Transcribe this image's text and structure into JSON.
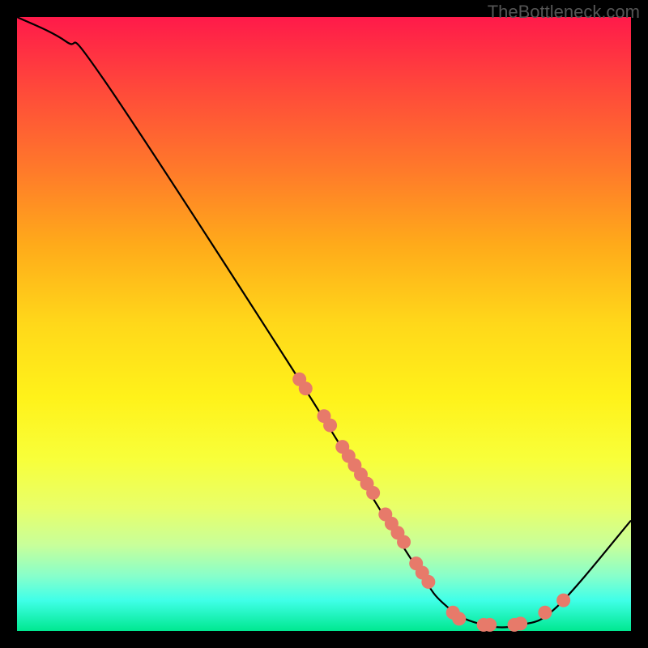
{
  "watermark": "TheBottleneck.com",
  "chart_data": {
    "type": "line",
    "title": "",
    "xlabel": "",
    "ylabel": "",
    "xlim": [
      0,
      100
    ],
    "ylim": [
      0,
      100
    ],
    "curve": [
      {
        "x": 0,
        "y": 100
      },
      {
        "x": 8,
        "y": 96
      },
      {
        "x": 14,
        "y": 90
      },
      {
        "x": 44,
        "y": 44
      },
      {
        "x": 64,
        "y": 12
      },
      {
        "x": 70,
        "y": 4
      },
      {
        "x": 76,
        "y": 1
      },
      {
        "x": 82,
        "y": 1
      },
      {
        "x": 88,
        "y": 4
      },
      {
        "x": 100,
        "y": 18
      }
    ],
    "curve_markers": [
      {
        "x": 46,
        "y": 41
      },
      {
        "x": 47,
        "y": 39.5
      },
      {
        "x": 50,
        "y": 35
      },
      {
        "x": 51,
        "y": 33.5
      },
      {
        "x": 53,
        "y": 30
      },
      {
        "x": 54,
        "y": 28.5
      },
      {
        "x": 55,
        "y": 27
      },
      {
        "x": 56,
        "y": 25.5
      },
      {
        "x": 57,
        "y": 24
      },
      {
        "x": 58,
        "y": 22.5
      },
      {
        "x": 60,
        "y": 19
      },
      {
        "x": 61,
        "y": 17.5
      },
      {
        "x": 62,
        "y": 16
      },
      {
        "x": 63,
        "y": 14.5
      },
      {
        "x": 65,
        "y": 11
      },
      {
        "x": 66,
        "y": 9.5
      },
      {
        "x": 67,
        "y": 8
      },
      {
        "x": 71,
        "y": 3
      },
      {
        "x": 72,
        "y": 2
      },
      {
        "x": 76,
        "y": 1
      },
      {
        "x": 77,
        "y": 1
      },
      {
        "x": 81,
        "y": 1
      },
      {
        "x": 82,
        "y": 1.2
      },
      {
        "x": 86,
        "y": 3
      },
      {
        "x": 89,
        "y": 5
      }
    ],
    "marker_color": "#e77a6a",
    "curve_color": "#000000"
  }
}
